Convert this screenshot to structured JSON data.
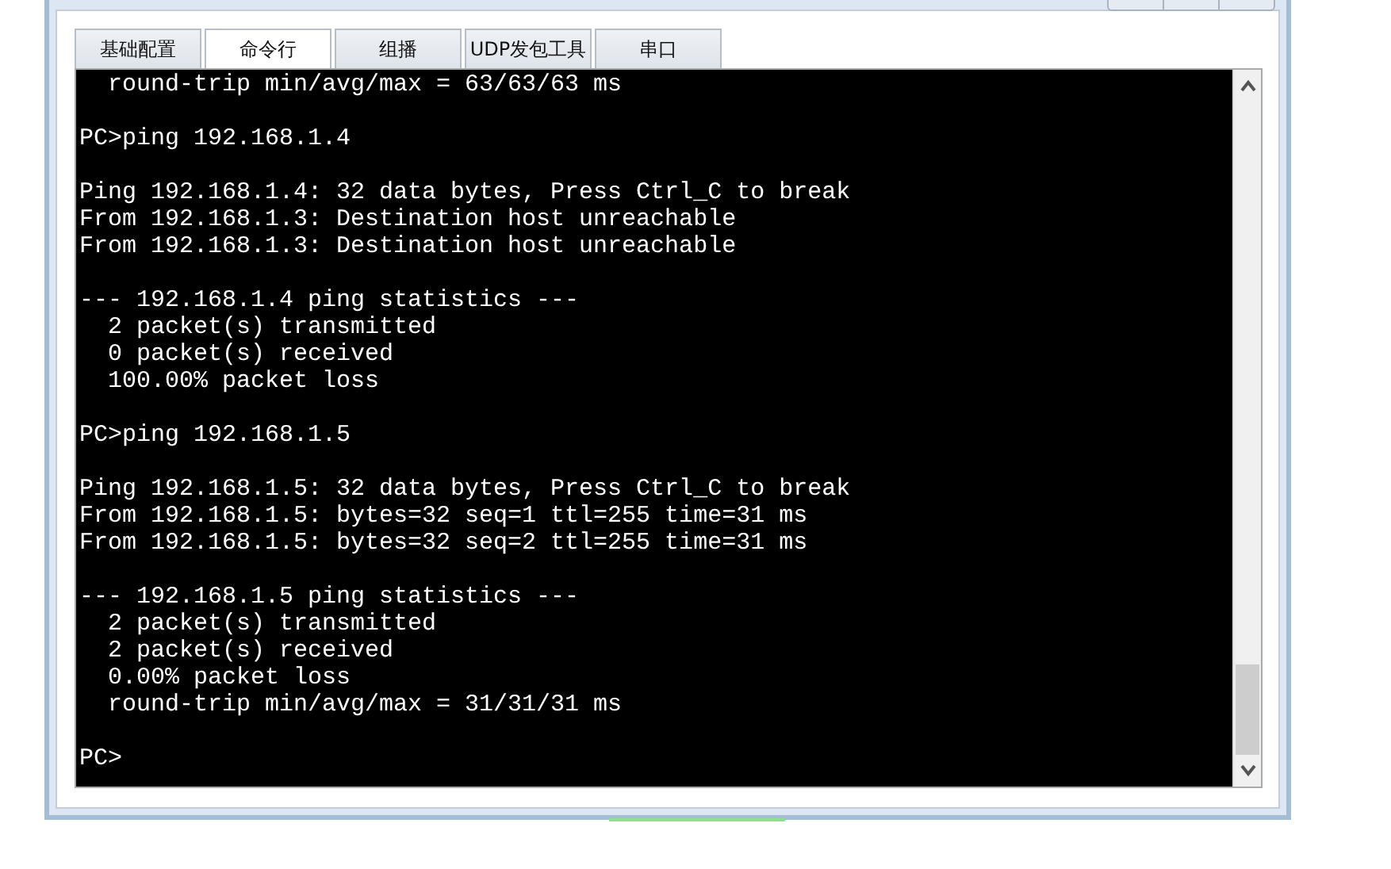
{
  "tabs": [
    {
      "label": "基础配置",
      "selected": false
    },
    {
      "label": "命令行",
      "selected": true
    },
    {
      "label": "组播",
      "selected": false
    },
    {
      "label": "UDP发包工具",
      "selected": false
    },
    {
      "label": "串口",
      "selected": false
    }
  ],
  "terminal": {
    "blocks": [
      [
        "  round-trip min/avg/max = 63/63/63 ms"
      ],
      [
        "PC>ping 192.168.1.4"
      ],
      [
        "Ping 192.168.1.4: 32 data bytes, Press Ctrl_C to break",
        "From 192.168.1.3: Destination host unreachable",
        "From 192.168.1.3: Destination host unreachable"
      ],
      [
        "--- 192.168.1.4 ping statistics ---",
        "  2 packet(s) transmitted",
        "  0 packet(s) received",
        "  100.00% packet loss"
      ],
      [
        "PC>ping 192.168.1.5"
      ],
      [
        "Ping 192.168.1.5: 32 data bytes, Press Ctrl_C to break",
        "From 192.168.1.5: bytes=32 seq=1 ttl=255 time=31 ms",
        "From 192.168.1.5: bytes=32 seq=2 ttl=255 time=31 ms"
      ],
      [
        "--- 192.168.1.5 ping statistics ---",
        "  2 packet(s) transmitted",
        "  2 packet(s) received",
        "  0.00% packet loss",
        "  round-trip min/avg/max = 31/31/31 ms"
      ],
      [
        "PC>"
      ]
    ]
  }
}
